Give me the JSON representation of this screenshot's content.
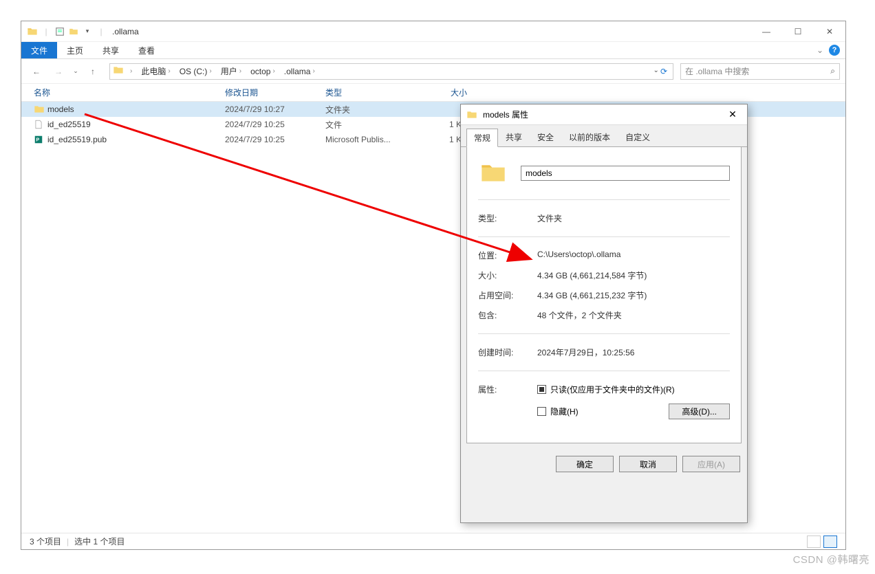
{
  "window": {
    "title": ".ollama",
    "sys_min": "—",
    "sys_max": "☐",
    "sys_close": "✕"
  },
  "ribbon": {
    "file": "文件",
    "home": "主页",
    "share": "共享",
    "view": "查看",
    "expand": "⌄"
  },
  "nav": {
    "back": "←",
    "forward": "→",
    "recent": "⌄",
    "up": "↑",
    "refresh": "⟳",
    "dropdown": "⌄"
  },
  "breadcrumb": {
    "items": [
      {
        "label": "此电脑"
      },
      {
        "label": "OS (C:)"
      },
      {
        "label": "用户"
      },
      {
        "label": "octop"
      },
      {
        "label": ".ollama"
      }
    ]
  },
  "search": {
    "placeholder": "在 .ollama 中搜索"
  },
  "columns": {
    "name": "名称",
    "date": "修改日期",
    "type": "类型",
    "size": "大小"
  },
  "files": [
    {
      "name": "models",
      "date": "2024/7/29 10:27",
      "type": "文件夹",
      "size": "",
      "icon": "folder",
      "selected": true
    },
    {
      "name": "id_ed25519",
      "date": "2024/7/29 10:25",
      "type": "文件",
      "size": "1 KB",
      "icon": "file",
      "selected": false
    },
    {
      "name": "id_ed25519.pub",
      "date": "2024/7/29 10:25",
      "type": "Microsoft Publis...",
      "size": "1 KB",
      "icon": "pub",
      "selected": false
    }
  ],
  "status": {
    "total": "3 个项目",
    "selected": "选中 1 个项目"
  },
  "properties": {
    "title": "models 属性",
    "close": "✕",
    "tabs": {
      "general": "常规",
      "share": "共享",
      "security": "安全",
      "previous": "以前的版本",
      "custom": "自定义"
    },
    "name": "models",
    "labels": {
      "type": "类型:",
      "location": "位置:",
      "size": "大小:",
      "ondisk": "占用空间:",
      "contains": "包含:",
      "created": "创建时间:",
      "attributes": "属性:"
    },
    "type_val": "文件夹",
    "location_val": "C:\\Users\\octop\\.ollama",
    "size_val": "4.34 GB (4,661,214,584 字节)",
    "ondisk_val": "4.34 GB (4,661,215,232 字节)",
    "contains_val": "48 个文件，2 个文件夹",
    "created_val": "2024年7月29日，10:25:56",
    "readonly": "只读(仅应用于文件夹中的文件)(R)",
    "hidden": "隐藏(H)",
    "advanced": "高级(D)...",
    "ok": "确定",
    "cancel": "取消",
    "apply": "应用(A)"
  },
  "watermark": "CSDN @韩曙亮"
}
